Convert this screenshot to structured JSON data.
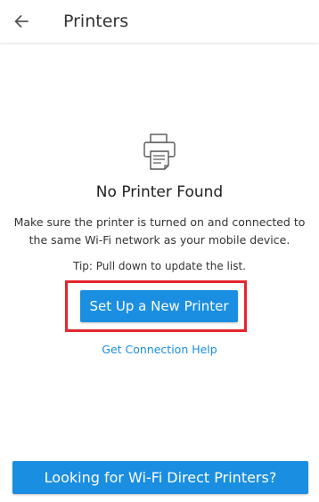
{
  "app_bar": {
    "back_icon": "arrow-left-icon",
    "title": "Printers"
  },
  "empty_state": {
    "icon": "printer-icon",
    "heading": "No Printer Found",
    "message": "Make sure the printer is turned on and connected to the same Wi-Fi network as your mobile device.",
    "tip": "Tip: Pull down to update the list."
  },
  "actions": {
    "setup_button": "Set Up a New Printer",
    "help_link": "Get Connection Help",
    "wifi_direct_button": "Looking for Wi-Fi Direct Printers?"
  },
  "colors": {
    "accent": "#1a8ee0",
    "highlight": "#e3262d"
  }
}
